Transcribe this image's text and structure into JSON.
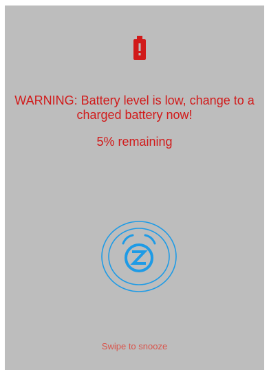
{
  "colors": {
    "background": "#bdbdbd",
    "warning_text": "#d11a1a",
    "battery_icon": "#d11a1a",
    "snooze_ring": "#1e9be6",
    "swipe_hint_text": "#d9534a"
  },
  "alert": {
    "icon": "battery-alert-icon",
    "warning_line1": "WARNING: Battery level is low, change to a",
    "warning_line2": "charged battery now!",
    "remaining_text": "5% remaining"
  },
  "snooze": {
    "icon": "alarm-snooze-icon",
    "hint": "Swipe to snooze"
  }
}
